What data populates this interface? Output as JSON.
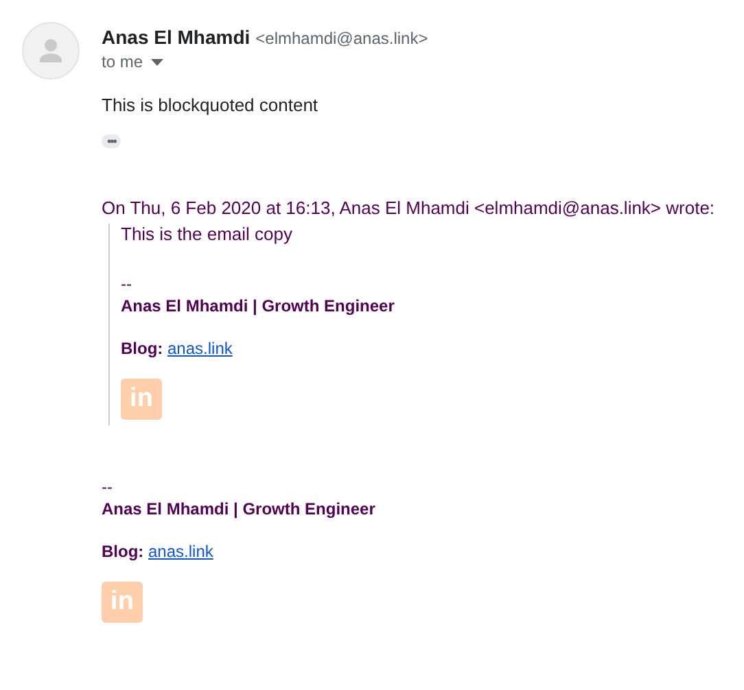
{
  "sender": {
    "name": "Anas El Mhamdi",
    "email": "<elmhamdi@anas.link>",
    "recipient": "to me"
  },
  "body": "This is blockquoted content",
  "trimmed_toggle": "•••",
  "quote": {
    "attribution": "On Thu, 6 Feb 2020 at 16:13, Anas El Mhamdi <elmhamdi@anas.link> wrote:",
    "text": "This is the email copy",
    "signature": {
      "dashes": "--",
      "name_line": "Anas El Mhamdi | Growth Engineer",
      "blog_label": "Blog:",
      "blog_link": "anas.link",
      "linkedin_label": "in"
    }
  },
  "signature": {
    "dashes": "--",
    "name_line": "Anas El Mhamdi | Growth Engineer",
    "blog_label": "Blog:",
    "blog_link": "anas.link",
    "linkedin_label": "in"
  }
}
